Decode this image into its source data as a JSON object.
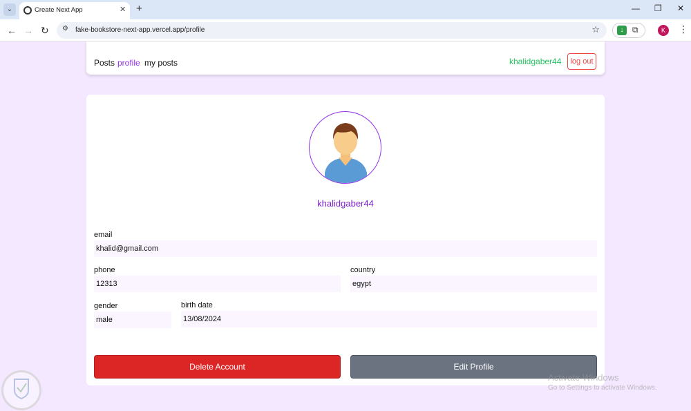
{
  "browser": {
    "tab_title": "Create Next App",
    "url": "fake-bookstore-next-app.vercel.app/profile",
    "profile_initial": "K"
  },
  "header": {
    "nav": [
      {
        "label": "Posts",
        "active": false
      },
      {
        "label": "profile",
        "active": true
      },
      {
        "label": "my posts",
        "active": false
      }
    ],
    "username": "khalidgaber44",
    "logout_label": "log out"
  },
  "profile": {
    "username": "khalidgaber44",
    "fields": {
      "email": {
        "label": "email",
        "value": "khalid@gmail.com"
      },
      "phone": {
        "label": "phone",
        "value": "12313"
      },
      "country": {
        "label": "country",
        "value": "egypt"
      },
      "gender": {
        "label": "gender",
        "value": "male"
      },
      "birth_date": {
        "label": "birth date",
        "value": "13/08/2024"
      }
    },
    "delete_label": "Delete Account",
    "edit_label": "Edit Profile"
  },
  "overlay": {
    "activate_title": "Activate Windows",
    "activate_sub": "Go to Settings to activate Windows."
  },
  "colors": {
    "page_bg": "#f3e8ff",
    "accent": "#9333ea",
    "username_green": "#22c55e",
    "danger": "#dc2626",
    "secondary": "#6b7280"
  }
}
